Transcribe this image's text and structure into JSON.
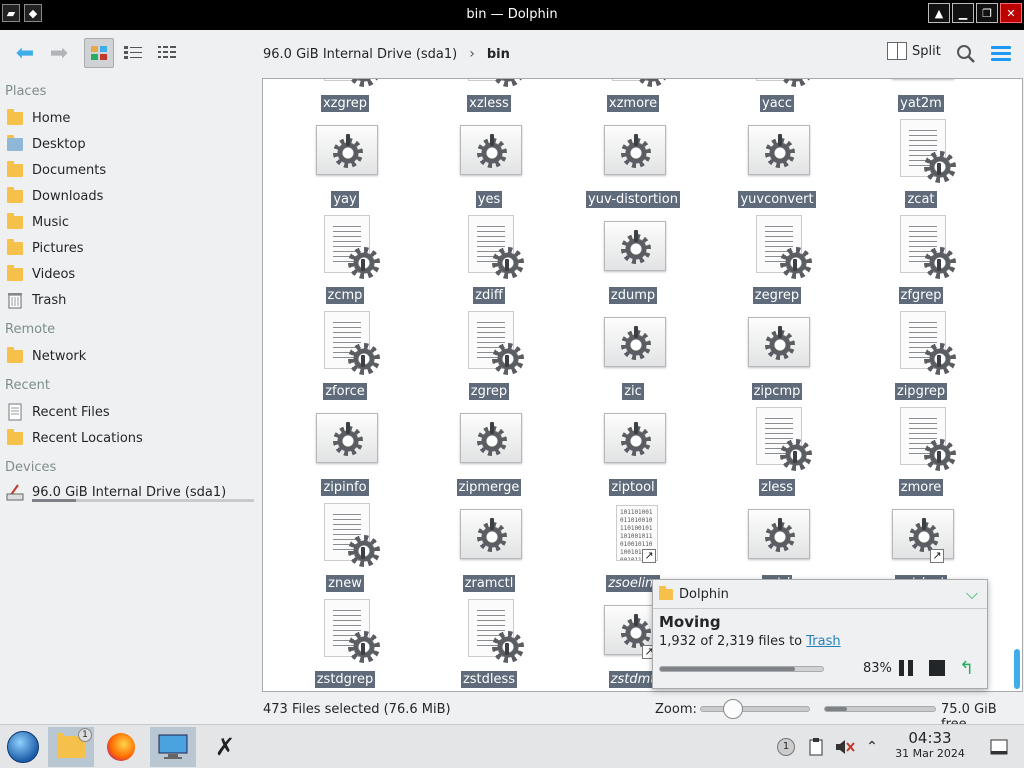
{
  "window": {
    "title": "bin — Dolphin"
  },
  "toolbar": {
    "split_label": "Split",
    "breadcrumb": [
      "96.0 GiB Internal Drive (sda1)",
      "bin"
    ]
  },
  "sidebar": {
    "places_header": "Places",
    "places": [
      "Home",
      "Desktop",
      "Documents",
      "Downloads",
      "Music",
      "Pictures",
      "Videos",
      "Trash"
    ],
    "remote_header": "Remote",
    "remote": [
      "Network"
    ],
    "recent_header": "Recent",
    "recent": [
      "Recent Files",
      "Recent Locations"
    ],
    "devices_header": "Devices",
    "devices": [
      "96.0 GiB Internal Drive (sda1)"
    ],
    "drive_usage_fraction": 0.2
  },
  "files": [
    {
      "name": "xzgrep",
      "kind": "script"
    },
    {
      "name": "xzless",
      "kind": "script"
    },
    {
      "name": "xzmore",
      "kind": "script"
    },
    {
      "name": "yacc",
      "kind": "script"
    },
    {
      "name": "yat2m",
      "kind": "exec"
    },
    {
      "name": "yay",
      "kind": "exec"
    },
    {
      "name": "yes",
      "kind": "exec"
    },
    {
      "name": "yuv-distortion",
      "kind": "exec"
    },
    {
      "name": "yuvconvert",
      "kind": "exec"
    },
    {
      "name": "zcat",
      "kind": "script"
    },
    {
      "name": "zcmp",
      "kind": "script"
    },
    {
      "name": "zdiff",
      "kind": "script"
    },
    {
      "name": "zdump",
      "kind": "exec"
    },
    {
      "name": "zegrep",
      "kind": "script"
    },
    {
      "name": "zfgrep",
      "kind": "script"
    },
    {
      "name": "zforce",
      "kind": "script"
    },
    {
      "name": "zgrep",
      "kind": "script"
    },
    {
      "name": "zic",
      "kind": "exec"
    },
    {
      "name": "zipcmp",
      "kind": "exec"
    },
    {
      "name": "zipgrep",
      "kind": "script"
    },
    {
      "name": "zipinfo",
      "kind": "exec"
    },
    {
      "name": "zipmerge",
      "kind": "exec"
    },
    {
      "name": "ziptool",
      "kind": "exec"
    },
    {
      "name": "zless",
      "kind": "script"
    },
    {
      "name": "zmore",
      "kind": "script"
    },
    {
      "name": "znew",
      "kind": "script"
    },
    {
      "name": "zramctl",
      "kind": "exec"
    },
    {
      "name": "zsoelim",
      "kind": "binary-link"
    },
    {
      "name": "zstd",
      "kind": "exec"
    },
    {
      "name": "zstdcat",
      "kind": "exec-link"
    },
    {
      "name": "zstdgrep",
      "kind": "script"
    },
    {
      "name": "zstdless",
      "kind": "script"
    },
    {
      "name": "zstdmt",
      "kind": "exec-link"
    }
  ],
  "notification": {
    "app": "Dolphin",
    "title": "Moving",
    "body_prefix": "1,932 of 2,319 files to",
    "link": "Trash",
    "percent": "83%",
    "progress_fraction": 0.83
  },
  "status": {
    "selection": "473 Files selected (76.6 MiB)",
    "zoom_label": "Zoom:",
    "zoom_fraction": 0.3,
    "free_space": "75.0 GiB free",
    "disk_used_fraction": 0.2
  },
  "taskbar": {
    "file_manager_badge": "1",
    "notification_count": "1",
    "time": "04:33",
    "date": "31 Mar 2024"
  },
  "colors": {
    "accent": "#3daee9",
    "selection_label": "#5f6b7a",
    "link": "#2980b9"
  },
  "icons": [
    "arrow-left-icon",
    "arrow-right-icon",
    "icons-view-icon",
    "compact-view-icon",
    "details-view-icon",
    "split-icon",
    "search-icon",
    "hamburger-menu-icon"
  ]
}
